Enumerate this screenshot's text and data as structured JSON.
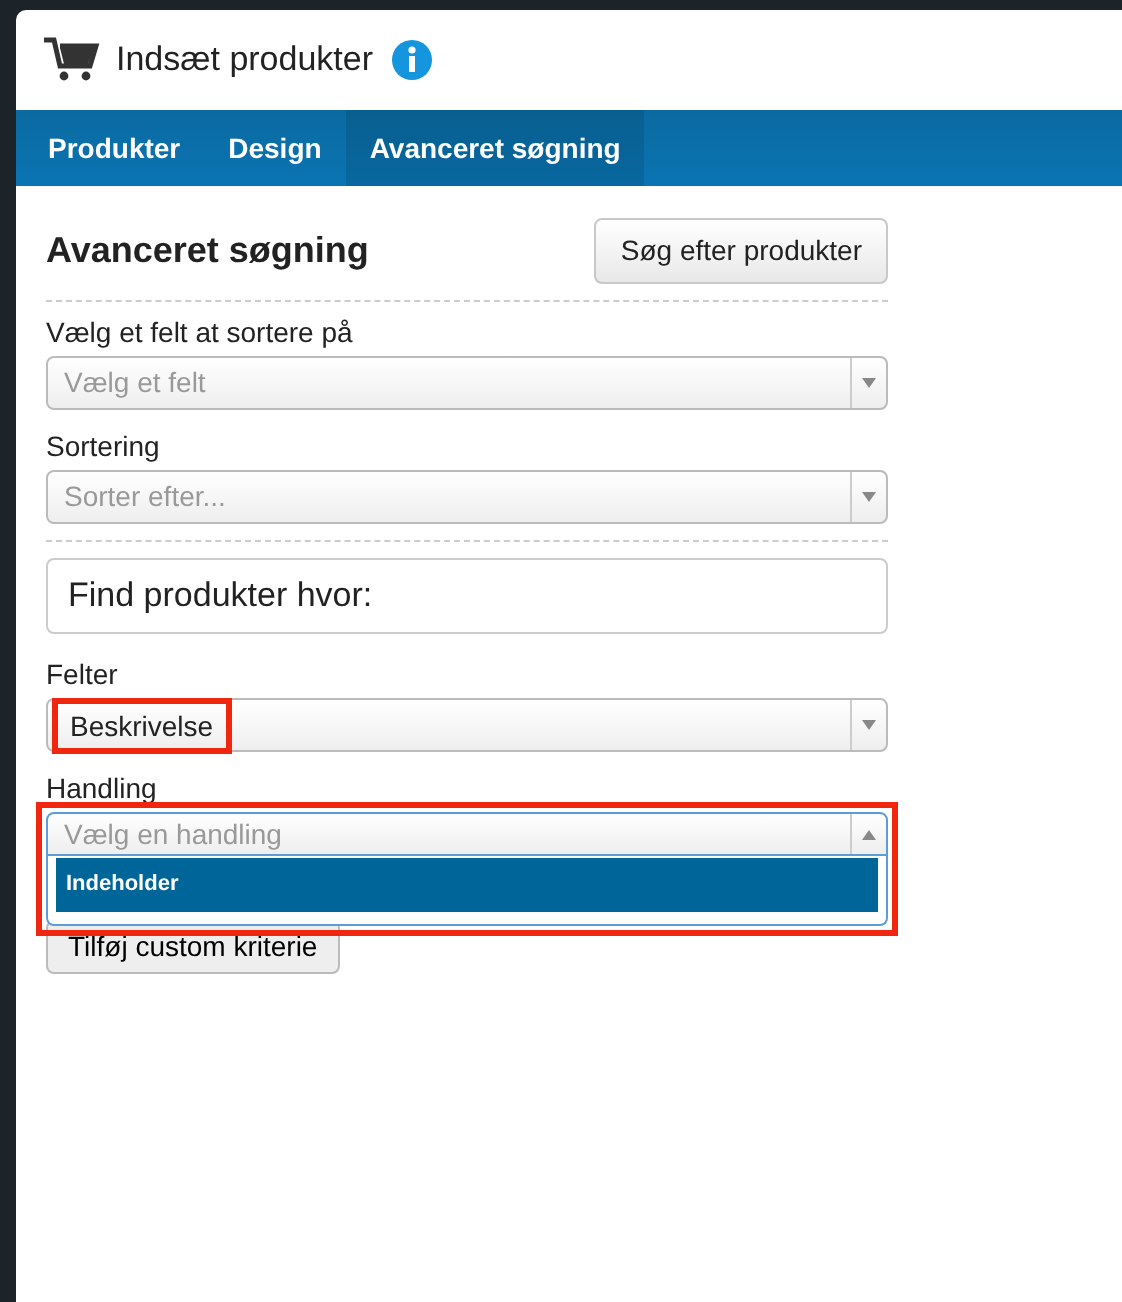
{
  "window": {
    "title": "Indsæt produkter"
  },
  "tabs": [
    {
      "label": "Produkter",
      "selected": false
    },
    {
      "label": "Design",
      "selected": false
    },
    {
      "label": "Avanceret søgning",
      "selected": true
    }
  ],
  "panel": {
    "heading": "Avanceret søgning",
    "search_button": "Søg efter produkter"
  },
  "sort_fields": [
    {
      "label": "Vælg et felt at sortere på",
      "placeholder": "Vælg et felt"
    },
    {
      "label": "Sortering",
      "placeholder": "Sorter efter..."
    }
  ],
  "criteria": {
    "heading": "Find produkter hvor:",
    "fields": [
      {
        "label": "Felter",
        "value": "Beskrivelse",
        "highlighted": true,
        "expanded": false
      },
      {
        "label": "Handling",
        "placeholder": "Vælg en handling",
        "highlighted": true,
        "expanded": true,
        "options": [
          {
            "label": "Indeholder",
            "selected": true
          }
        ]
      }
    ],
    "add_button": "Tilføj custom kriterie"
  }
}
